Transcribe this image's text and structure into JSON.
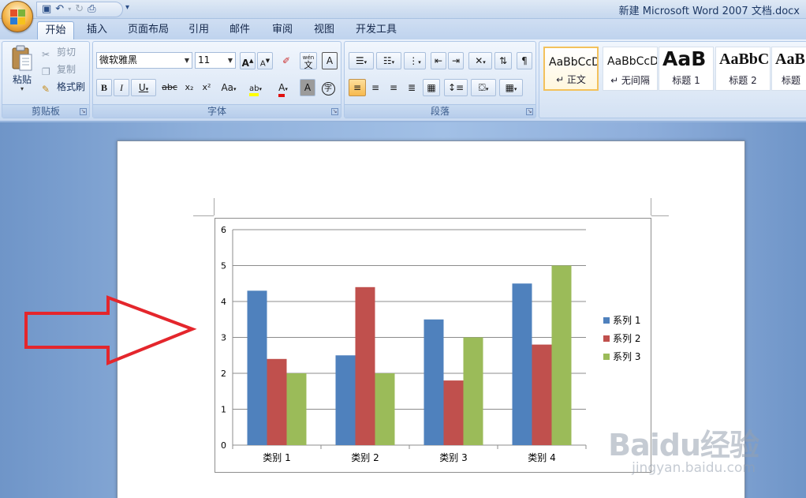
{
  "window": {
    "title": "新建 Microsoft Word 2007 文档.docx"
  },
  "tabs": [
    {
      "label": "开始",
      "active": true
    },
    {
      "label": "插入"
    },
    {
      "label": "页面布局"
    },
    {
      "label": "引用"
    },
    {
      "label": "邮件"
    },
    {
      "label": "审阅"
    },
    {
      "label": "视图"
    },
    {
      "label": "开发工具"
    }
  ],
  "clipboard": {
    "group_label": "剪贴板",
    "paste": "粘贴",
    "cut": "剪切",
    "copy": "复制",
    "format_painter": "格式刷"
  },
  "font": {
    "group_label": "字体",
    "font_name": "微软雅黑",
    "font_size": "11",
    "buttons": {
      "bold": "B",
      "italic": "I",
      "underline": "U",
      "strike": "abc",
      "sub": "x₂",
      "sup": "x²",
      "case": "Aa",
      "grow": "A",
      "shrink": "A",
      "wen": "文",
      "char_border": "A",
      "highlight": "ab",
      "font_color": "A",
      "char_shading": "A",
      "enclose": "字",
      "pinyin": "wén"
    },
    "highlight_color": "#ffff00",
    "font_color": "#e01010"
  },
  "paragraph": {
    "group_label": "段落"
  },
  "styles": [
    {
      "sample": "AaBbCcD",
      "name": "↵ 正文",
      "selected": true
    },
    {
      "sample": "AaBbCcD",
      "name": "↵ 无间隔"
    },
    {
      "sample": "AaB",
      "name": "标题 1"
    },
    {
      "sample": "AaBbC",
      "name": "标题 2"
    },
    {
      "sample": "AaB",
      "name": "标题"
    }
  ],
  "chart_data": {
    "type": "bar",
    "categories": [
      "类别 1",
      "类别 2",
      "类别 3",
      "类别 4"
    ],
    "series": [
      {
        "name": "系列 1",
        "values": [
          4.3,
          2.5,
          3.5,
          4.5
        ],
        "color": "#4f81bd"
      },
      {
        "name": "系列 2",
        "values": [
          2.4,
          4.4,
          1.8,
          2.8
        ],
        "color": "#c0504d"
      },
      {
        "name": "系列 3",
        "values": [
          2.0,
          2.0,
          3.0,
          5.0
        ],
        "color": "#9bbb59"
      }
    ],
    "yticks": [
      "0",
      "1",
      "2",
      "3",
      "4",
      "5",
      "6"
    ],
    "ylim": [
      0,
      6
    ],
    "grid": true,
    "legend": "right"
  },
  "annotation": {
    "arrow_color": "#e4262c"
  },
  "watermark": {
    "brand": "Baidu经验",
    "url": "jingyan.baidu.com"
  }
}
